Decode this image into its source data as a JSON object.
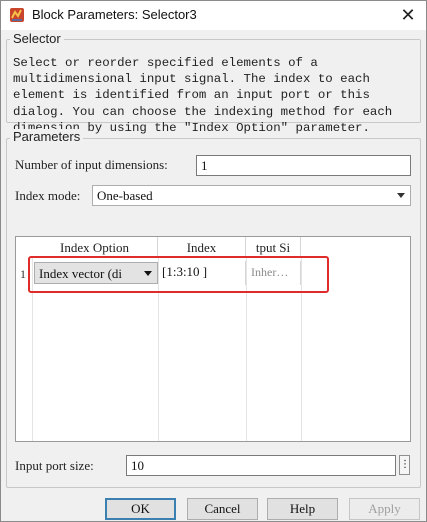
{
  "window": {
    "title": "Block Parameters: Selector3",
    "close_glyph": "✕"
  },
  "selector_group": {
    "label": "Selector",
    "description": "Select or reorder specified elements of a multidimensional input signal. The index to each element is identified from an input port or this dialog. You can choose the indexing method for each dimension by using the \"Index Option\" parameter."
  },
  "parameters_group": {
    "label": "Parameters",
    "num_dims_label": "Number of input dimensions:",
    "num_dims_value": "1",
    "index_mode_label": "Index mode:",
    "index_mode_value": "One-based"
  },
  "table": {
    "headers": [
      "Index Option",
      "Index",
      "tput Si"
    ],
    "rows": [
      {
        "num": "1",
        "index_option": "Index vector (di",
        "index": "[1:3:10 ]",
        "output_size": "Inher…"
      }
    ]
  },
  "input_port": {
    "label": "Input port size:",
    "value": "10",
    "dots": "⋮"
  },
  "buttons": {
    "ok": "OK",
    "cancel": "Cancel",
    "help": "Help",
    "apply": "Apply"
  },
  "colors": {
    "highlight": "#e02b2b",
    "default_button_border": "#3c7fb1"
  },
  "icons": {
    "app": "simulink-block-icon",
    "close": "close-icon"
  }
}
